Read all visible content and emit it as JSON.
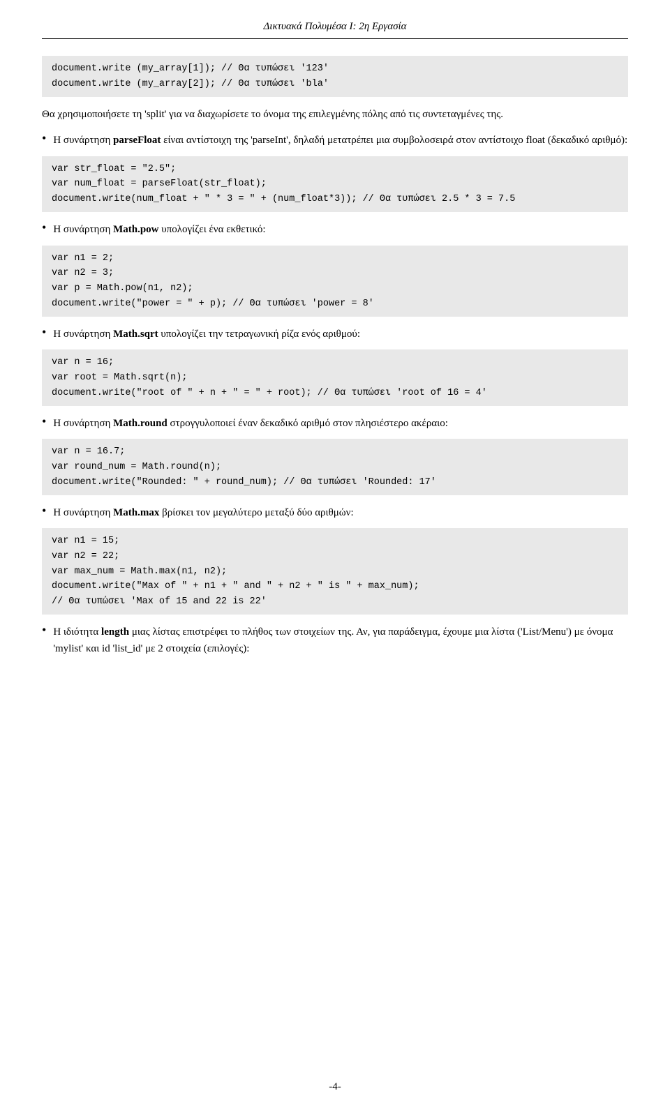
{
  "header": {
    "title": "Δικτυακά Πολυμέσα Ι: 2η Εργασία"
  },
  "footer": {
    "page_number": "-4-"
  },
  "content": {
    "code_block_1": "document.write (my_array[1]); // Θα τυπώσει '123'\ndocument.write (my_array[2]); // Θα τυπώσει 'bla'",
    "text_1": "Θα χρησιμοποιήσετε τη 'split' για να διαχωρίσετε το όνομα της επιλεγμένης πόλης από τις συντεταγμένες της.",
    "bullet_2_text_before": "Η συνάρτηση ",
    "bullet_2_bold": "parseFloat",
    "bullet_2_text_after": " είναι αντίστοιχη της 'parseInt', δηλαδή μετατρέπει μια συμβολοσειρά στον αντίστοιχο float (δεκαδικό αριθμό):",
    "code_block_2": "var str_float = \"2.5\";\nvar num_float = parseFloat(str_float);\ndocument.write(num_float + \" * 3 = \" + (num_float*3)); // Θα τυπώσει 2.5 * 3 = 7.5",
    "bullet_3_text_before": "Η συνάρτηση ",
    "bullet_3_bold": "Math.pow",
    "bullet_3_text_after": " υπολογίζει ένα εκθετικό:",
    "code_block_3": "var n1 = 2;\nvar n2 = 3;\nvar p = Math.pow(n1, n2);\ndocument.write(\"power = \" + p); // Θα τυπώσει 'power = 8'",
    "bullet_4_text_before": "Η συνάρτηση ",
    "bullet_4_bold": "Math.sqrt",
    "bullet_4_text_after": " υπολογίζει την τετραγωνική ρίζα ενός αριθμού:",
    "code_block_4": "var n = 16;\nvar root = Math.sqrt(n);\ndocument.write(\"root of \" + n + \" = \" + root); // Θα τυπώσει 'root of 16 = 4'",
    "bullet_5_text_before": "Η συνάρτηση ",
    "bullet_5_bold": "Math.round",
    "bullet_5_text_after": " στρογγυλοποιεί έναν δεκαδικό αριθμό στον πλησιέστερο ακέραιο:",
    "code_block_5": "var n = 16.7;\nvar round_num = Math.round(n);\ndocument.write(\"Rounded: \" + round_num); // Θα τυπώσει 'Rounded: 17'",
    "bullet_6_text_before": "Η συνάρτηση ",
    "bullet_6_bold": "Math.max",
    "bullet_6_text_after": " βρίσκει τον μεγαλύτερο μεταξύ δύο αριθμών:",
    "code_block_6": "var n1 = 15;\nvar n2 = 22;\nvar max_num = Math.max(n1, n2);\ndocument.write(\"Max of \" + n1 + \" and \" + n2 + \" is \" + max_num);\n// Θα τυπώσει 'Max of 15 and 22 is 22'",
    "bullet_7_text": "Η ιδιότητα ",
    "bullet_7_bold": "length",
    "bullet_7_text_after": " μιας λίστας επιστρέφει το πλήθος των στοιχείων της. Αν, για παράδειγμα, έχουμε μια λίστα ('List/Menu') με όνομα 'mylist' και id 'list_id' με 2 στοιχεία (επιλογές):"
  }
}
